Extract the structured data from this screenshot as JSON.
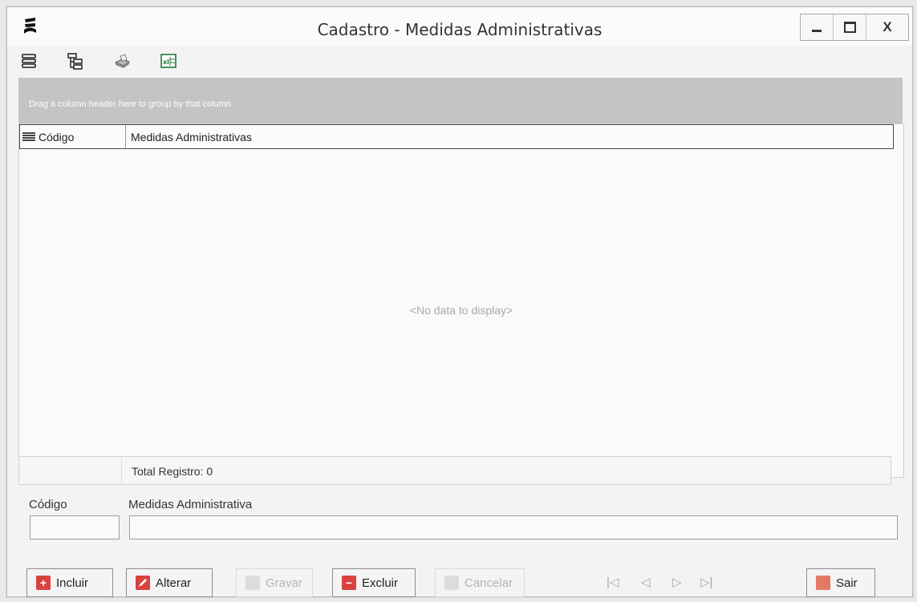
{
  "window": {
    "title": "Cadastro - Medidas Administrativas",
    "close_label": "X"
  },
  "toolbar": {
    "items": [
      {
        "icon": "grid-layout-icon"
      },
      {
        "icon": "tree-view-icon"
      },
      {
        "icon": "print-icon"
      },
      {
        "icon": "excel-export-icon"
      }
    ]
  },
  "grid": {
    "group_panel_text": "Drag a column header here to group by that column",
    "columns": [
      "Código",
      "Medidas Administrativas"
    ],
    "empty_text": "<No data to display>",
    "footer_total": "Total Registro: 0"
  },
  "form": {
    "code_label": "Código",
    "code_value": "",
    "medida_label": "Medidas Administrativa",
    "medida_value": ""
  },
  "buttons": {
    "incluir": "Incluir",
    "alterar": "Alterar",
    "gravar": "Gravar",
    "excluir": "Excluir",
    "cancelar": "Cancelar",
    "sair": "Sair"
  },
  "navigation": {
    "first": "|◁",
    "prev": "◁",
    "next": "▷",
    "last": "▷|"
  },
  "colors": {
    "incluir_icon": "#d9423f",
    "alterar_icon": "#d9423f",
    "excluir_icon": "#d9423f",
    "sair_icon": "#e27962",
    "group_panel": "#c4c4c4",
    "excel_icon": "#1f7a3d"
  }
}
